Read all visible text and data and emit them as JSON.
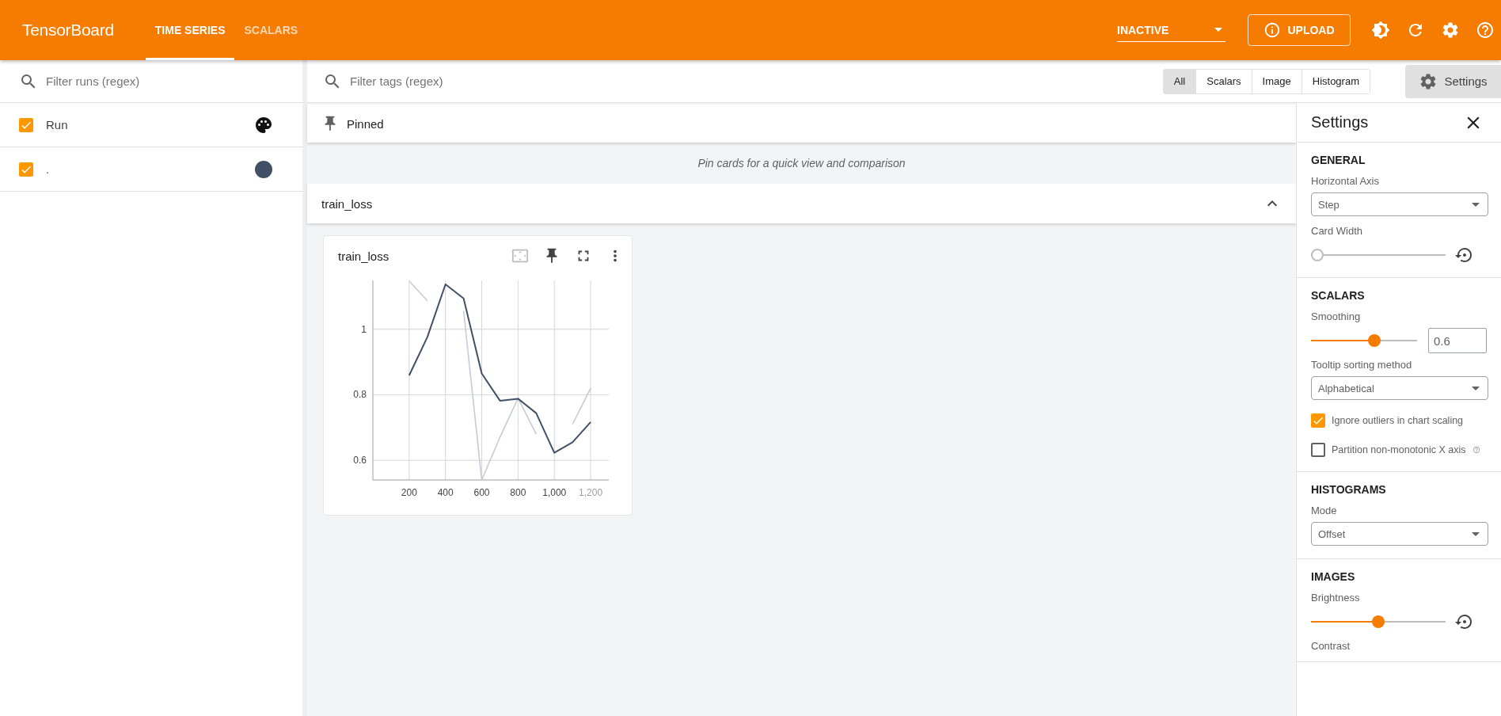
{
  "header": {
    "title": "TensorBoard",
    "tabs": [
      {
        "label": "TIME SERIES",
        "selected": true
      },
      {
        "label": "SCALARS",
        "selected": false
      }
    ],
    "run_selector": {
      "value": "INACTIVE"
    },
    "upload_button": "UPLOAD"
  },
  "runs_panel": {
    "filter": {
      "placeholder": "Filter runs (regex)"
    },
    "runs": [
      {
        "kind": "header",
        "name": "Run",
        "checked": true
      },
      {
        "kind": "run",
        "name": ".",
        "checked": true,
        "color": "#425066"
      }
    ]
  },
  "toolbar": {
    "filter": {
      "placeholder": "Filter tags (regex)"
    },
    "type_filters": [
      {
        "label": "All",
        "selected": true
      },
      {
        "label": "Scalars",
        "selected": false
      },
      {
        "label": "Image",
        "selected": false
      },
      {
        "label": "Histogram",
        "selected": false
      }
    ],
    "settings_button": "Settings"
  },
  "pinned": {
    "title": "Pinned",
    "empty_message": "Pin cards for a quick view and comparison"
  },
  "groups": [
    {
      "title": "train_loss",
      "expanded": true,
      "cards": [
        {
          "title": "train_loss",
          "chart_data": {
            "type": "line",
            "x": [
              200,
              300,
              400,
              500,
              600,
              700,
              800,
              900,
              1000,
              1100,
              1200
            ],
            "xlim": [
              0,
              1300
            ],
            "ylim": [
              0.54,
              1.149
            ],
            "grid": true,
            "xticks": [
              {
                "value": 200,
                "label": "200"
              },
              {
                "value": 400,
                "label": "400"
              },
              {
                "value": 600,
                "label": "600"
              },
              {
                "value": 800,
                "label": "800"
              },
              {
                "value": 1000,
                "label": "1,000"
              },
              {
                "value": 1200,
                "label": "1,200"
              }
            ],
            "yticks": [
              {
                "value": 0.6,
                "label": "0.6"
              },
              {
                "value": 0.8,
                "label": "0.8"
              },
              {
                "value": 1,
                "label": "1"
              }
            ],
            "series": [
              {
                "color": "#c6cbd6",
                "values": [
                  1.147,
                  1.087,
                  null,
                  1.056,
                  0.54,
                  0.67,
                  0.79,
                  0.68,
                  null,
                  0.71,
                  0.82
                ]
              },
              {
                "color": "#425066",
                "values": [
                  0.859,
                  0.976,
                  1.137,
                  1.094,
                  0.865,
                  0.782,
                  0.788,
                  0.744,
                  0.623,
                  0.655,
                  0.717
                ]
              }
            ]
          }
        }
      ]
    }
  ],
  "settings": {
    "title": "Settings",
    "sections": [
      {
        "title": "GENERAL",
        "items": [
          {
            "kind": "select",
            "label": "Horizontal Axis",
            "value": "Step"
          },
          {
            "kind": "slider",
            "label": "Card Width",
            "level": 0
          }
        ]
      },
      {
        "title": "SCALARS",
        "items": [
          {
            "kind": "slider_input",
            "label": "Smoothing",
            "level": 0.6,
            "value": "0.6"
          },
          {
            "kind": "select",
            "label": "Tooltip sorting method",
            "value": "Alphabetical"
          },
          {
            "kind": "checkbox",
            "label": "Ignore outliers in chart scaling",
            "checked": true
          },
          {
            "kind": "checkbox",
            "label": "Partition non-monotonic X axis",
            "checked": false,
            "help": true
          }
        ]
      },
      {
        "title": "HISTOGRAMS",
        "items": [
          {
            "kind": "select",
            "label": "Mode",
            "value": "Offset"
          }
        ]
      },
      {
        "title": "IMAGES",
        "items": [
          {
            "kind": "slider",
            "label": "Brightness",
            "level": 0.5
          },
          {
            "kind": "label",
            "label": "Contrast"
          }
        ]
      }
    ]
  }
}
